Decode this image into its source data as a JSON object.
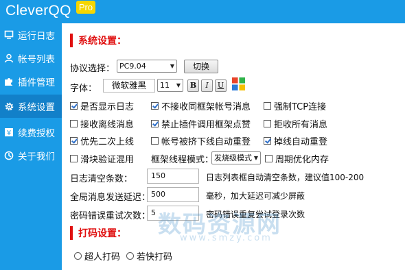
{
  "app": {
    "title": "CleverQQ",
    "badge": "Pro"
  },
  "sidebar": {
    "items": [
      {
        "label": "运行日志",
        "icon": "monitor-icon",
        "active": false
      },
      {
        "label": "帐号列表",
        "icon": "user-icon",
        "active": false
      },
      {
        "label": "插件管理",
        "icon": "puzzle-icon",
        "active": false
      },
      {
        "label": "系统设置",
        "icon": "gear-icon",
        "active": true
      },
      {
        "label": "续费授权",
        "icon": "yen-icon",
        "active": false
      },
      {
        "label": "关于我们",
        "icon": "info-icon",
        "active": false
      }
    ]
  },
  "system": {
    "title": "系统设置：",
    "protocol_label": "协议选择：",
    "protocol_value": "PC9.04",
    "switch_button": "切换",
    "font_label": "字体：",
    "font_name": "微软雅黑",
    "font_size": "11",
    "bold_label": "B",
    "italic_label": "I",
    "underline_label": "U",
    "options": [
      {
        "label": "是否显示日志",
        "checked": true
      },
      {
        "label": "不接收同框架帐号消息",
        "checked": true
      },
      {
        "label": "强制TCP连接",
        "checked": false
      },
      {
        "label": "接收离线消息",
        "checked": false
      },
      {
        "label": "禁止插件调用框架点赞",
        "checked": true
      },
      {
        "label": "拒收所有消息",
        "checked": false
      },
      {
        "label": "优先二次上线",
        "checked": true
      },
      {
        "label": "帐号被挤下线自动重登",
        "checked": false
      },
      {
        "label": "掉线自动重登",
        "checked": true
      },
      {
        "label": "滑块验证混用",
        "checked": false
      },
      {
        "label": "周期优化内存",
        "checked": false
      }
    ],
    "thread_mode_label": "框架线程模式：",
    "thread_mode_value": "发烧级模式",
    "log_clear_label": "日志清空条数：",
    "log_clear_value": "150",
    "log_clear_hint": "日志列表框自动清空条数，建议值100-200",
    "delay_label": "全局消息发送延迟：",
    "delay_value": "500",
    "delay_hint": "毫秒，加大延迟可减少屏蔽",
    "retry_label": "密码错误重试次数：",
    "retry_value": "5",
    "retry_hint": "密码错误重复尝试登录次数"
  },
  "captcha": {
    "title": "打码设置：",
    "option1": "超人打码",
    "option2": "若快打码"
  },
  "watermark": {
    "text": "数码资源网",
    "url": "www.smzy.com"
  },
  "colors": {
    "brand": "#1a9be6",
    "active_nav": "#1280c9",
    "accent_red": "#e01010",
    "badge": "#f5d600"
  }
}
